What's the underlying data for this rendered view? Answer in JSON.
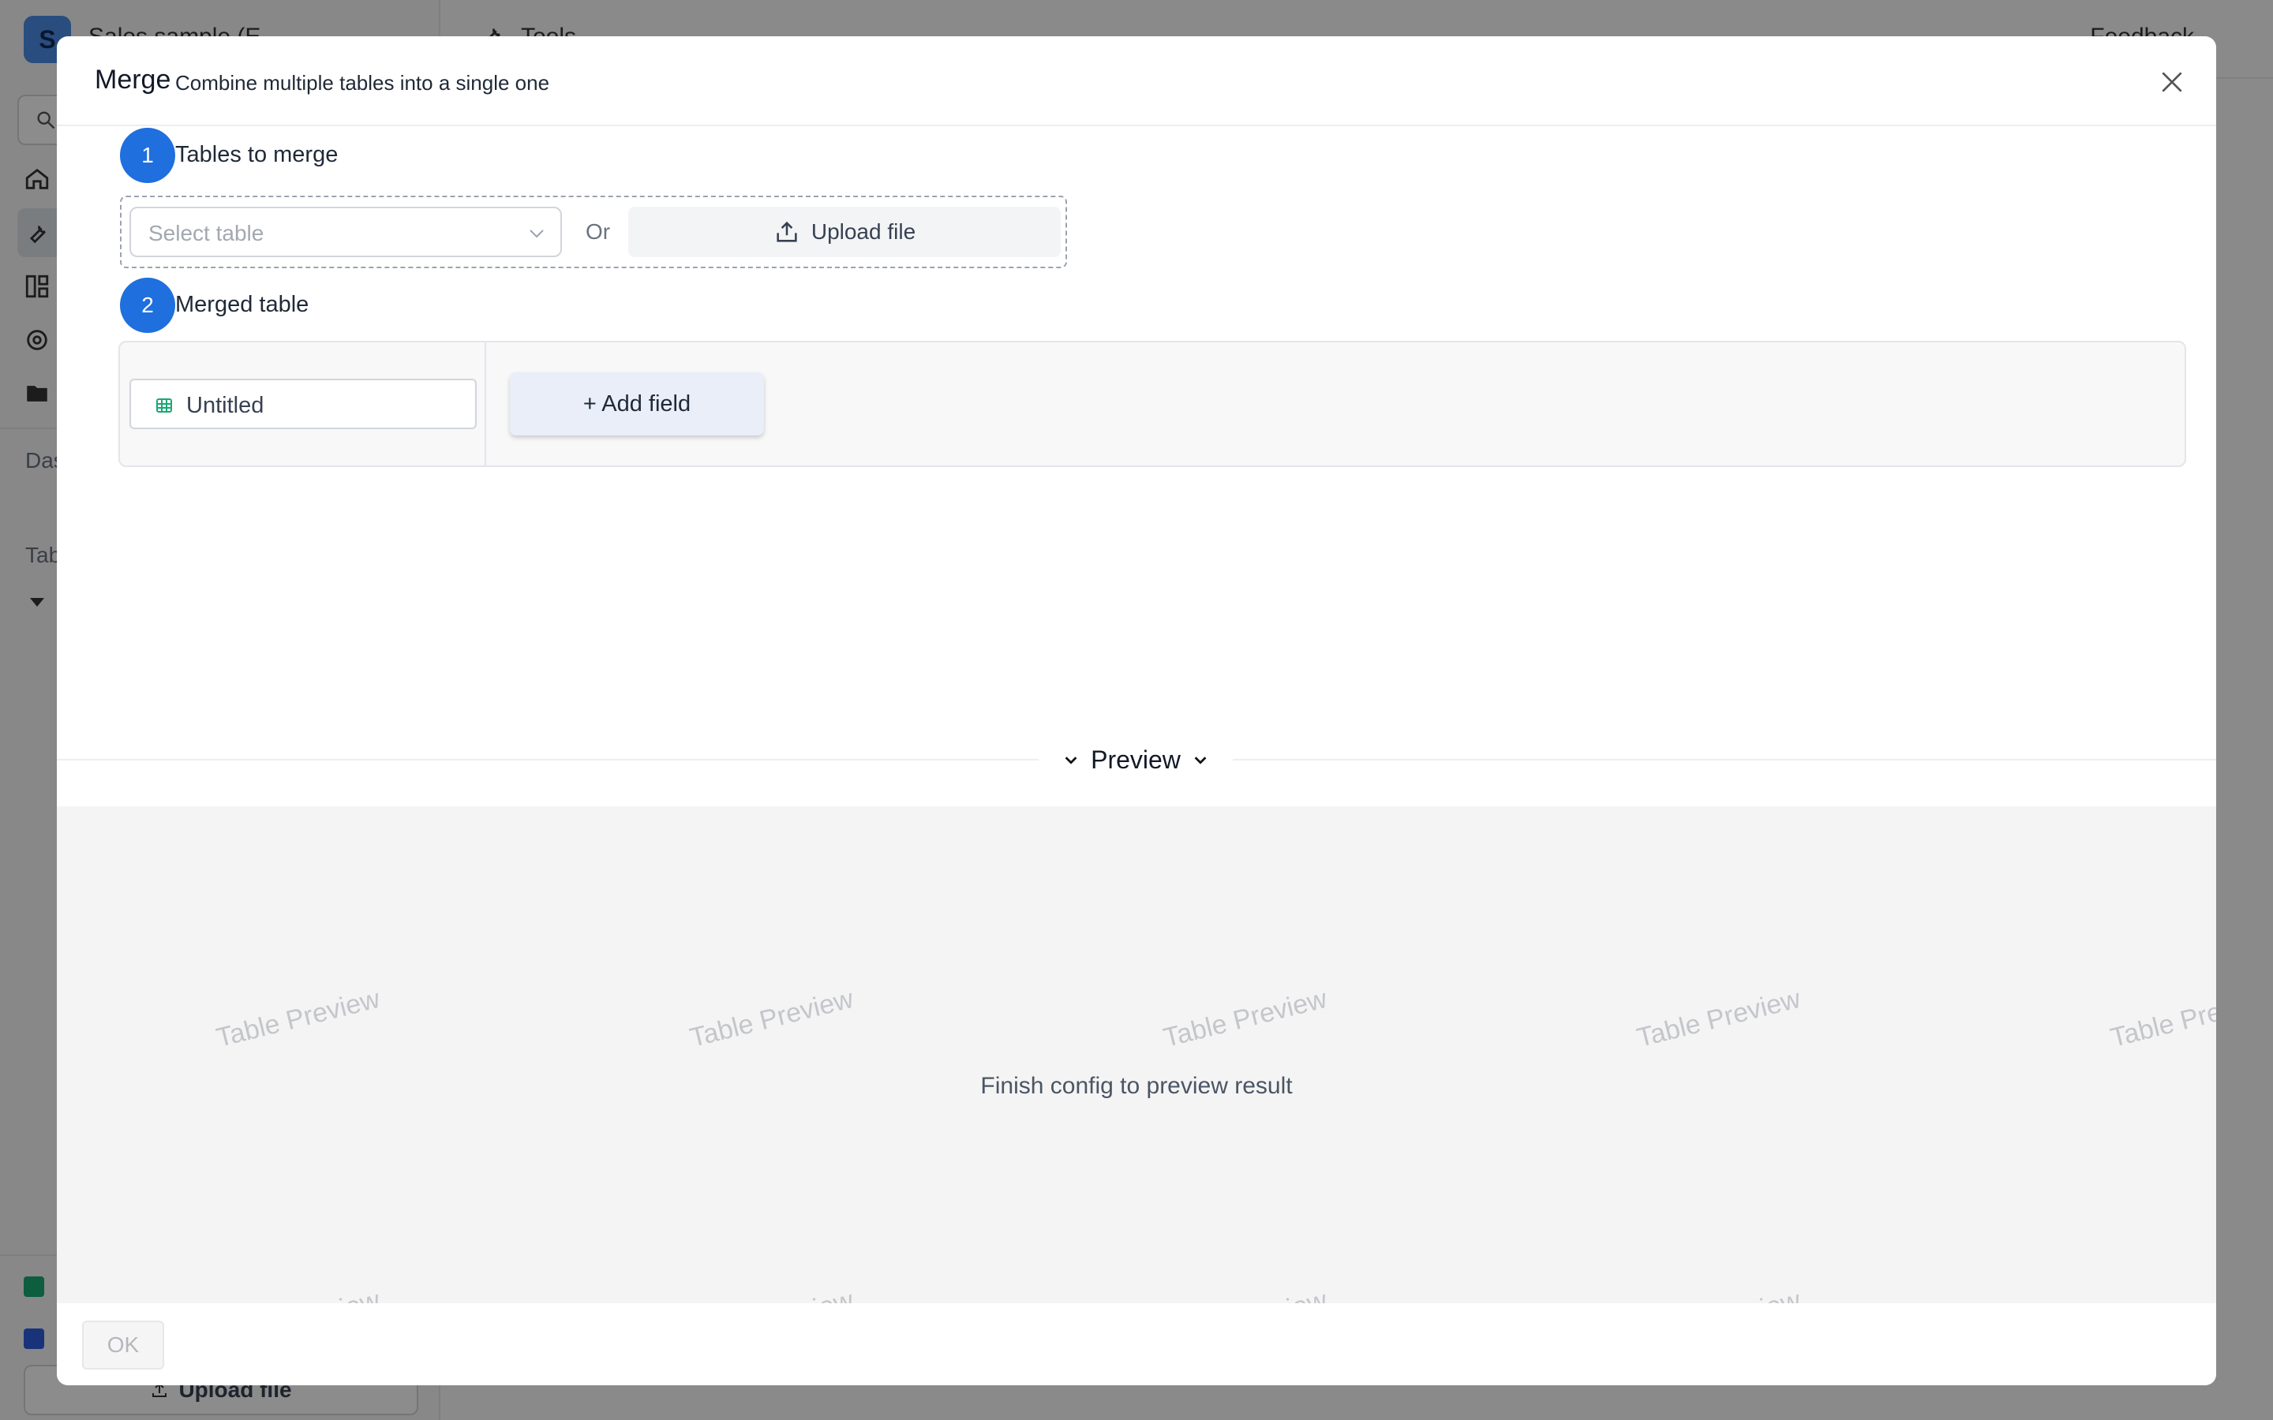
{
  "background": {
    "app_logo_letter": "S",
    "app_title": "Sales sample (E",
    "topbar_title": "Tools",
    "feedback_label": "Feedback",
    "section_dashboards": "Das",
    "section_tables": "Tab",
    "upload_label": "Upload file"
  },
  "modal": {
    "title": "Merge",
    "subtitle": "Combine multiple tables into a single one",
    "close_icon": "close-icon"
  },
  "step1": {
    "number": "1",
    "label": "Tables to merge",
    "select_placeholder": "Select table",
    "or_label": "Or",
    "upload_label": "Upload file"
  },
  "step2": {
    "number": "2",
    "label": "Merged table",
    "table_name": "Untitled",
    "add_field_label": "+ Add field"
  },
  "preview": {
    "toggle_label": "Preview",
    "watermark": "Table Preview",
    "message": "Finish config to preview result"
  },
  "footer": {
    "ok_label": "OK"
  },
  "colors": {
    "accent": "#1f6fde",
    "add_field_bg": "#e9eef9",
    "preview_bg": "#f4f4f5"
  }
}
